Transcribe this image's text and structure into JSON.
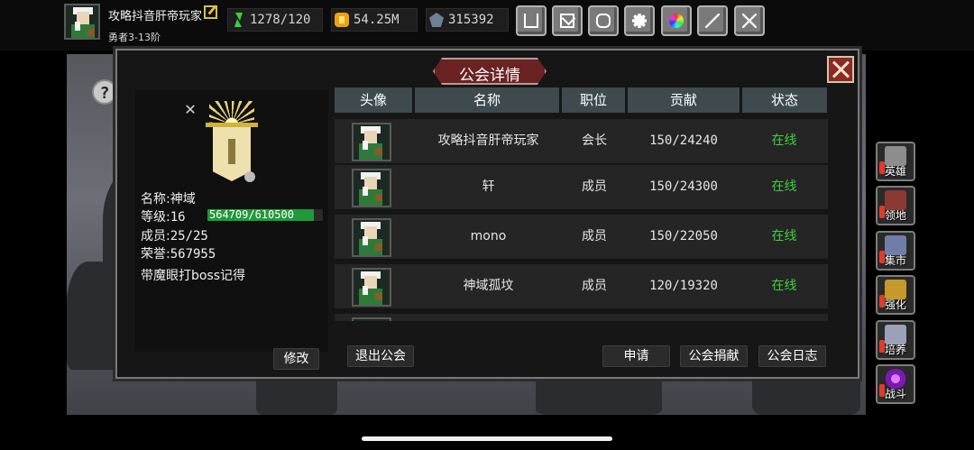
{
  "player": {
    "name": "攻略抖音肝帝玩家",
    "rank": "勇者3-13阶",
    "energy": "1278/120",
    "gold": "54.25M",
    "gems": "315392"
  },
  "icons": {
    "energy": "lightning-icon",
    "gold": "gold-coin-icon",
    "gems": "gem-icon",
    "toolbar": [
      "shop-cart-icon",
      "mail-icon",
      "gamepad-icon",
      "settings-gear-icon",
      "color-wheel-icon",
      "feather-icon",
      "crossed-swords-icon"
    ]
  },
  "dialog": {
    "title": "公会详情",
    "close_icon": "close-icon"
  },
  "guild": {
    "name_label": "名称:",
    "name": "神域",
    "level_label": "等级:",
    "level": "16",
    "exp": "564709/610500",
    "exp_fraction": 0.925,
    "members_label": "成员:",
    "members": "25/25",
    "honor_label": "荣誉:",
    "honor": "567955",
    "notice": "带魔眼打boss记得",
    "edit_button": "修改"
  },
  "table": {
    "headers": [
      "头像",
      "名称",
      "职位",
      "贡献",
      "状态"
    ],
    "rows": [
      {
        "name": "攻略抖音肝帝玩家",
        "role": "会长",
        "contribution": "150/24240",
        "status": "在线"
      },
      {
        "name": "轩",
        "role": "成员",
        "contribution": "150/24300",
        "status": "在线"
      },
      {
        "name": "mono",
        "role": "成员",
        "contribution": "150/22050",
        "status": "在线"
      },
      {
        "name": "神域孤坟",
        "role": "成员",
        "contribution": "120/19320",
        "status": "在线"
      }
    ]
  },
  "buttons": {
    "leave": "退出公会",
    "apply": "申请",
    "donate": "公会捐献",
    "log": "公会日志"
  },
  "side_menu": [
    {
      "label": "英雄",
      "icon": "hero-helmet-icon"
    },
    {
      "label": "领地",
      "icon": "territory-castle-icon"
    },
    {
      "label": "集市",
      "icon": "market-merchant-icon"
    },
    {
      "label": "强化",
      "icon": "enhance-crest-icon"
    },
    {
      "label": "培养",
      "icon": "training-icon"
    },
    {
      "label": "战斗",
      "icon": "battle-portal-icon"
    }
  ],
  "colors": {
    "online": "#3ed13e",
    "exp_bar": "#1f9a3a",
    "title_plate": "#6a2222",
    "header_bg": "#3e4a4e"
  }
}
